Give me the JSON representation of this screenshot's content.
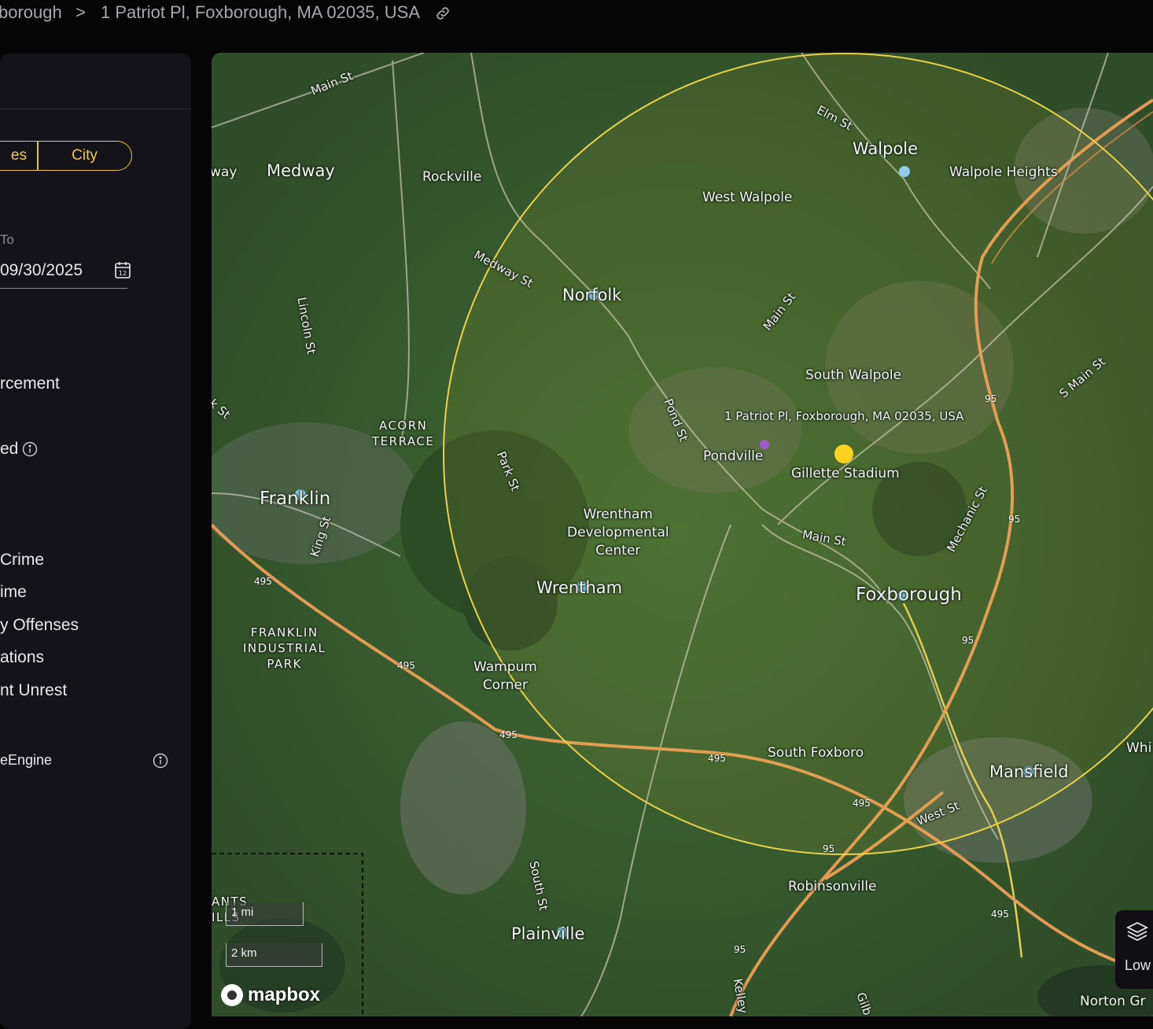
{
  "breadcrumb": {
    "parent": "borough",
    "separator": ">",
    "current": "1 Patriot Pl, Foxborough, MA 02035, USA"
  },
  "sidebar": {
    "segment": {
      "left": "es",
      "right": "City"
    },
    "date_to": {
      "label": "To",
      "value": "09/30/2025"
    },
    "items": [
      {
        "label": "rcement"
      },
      {
        "label": "ed"
      },
      {
        "label": "Crime"
      },
      {
        "label": "ime"
      },
      {
        "label": "y Offenses"
      },
      {
        "label": "ations"
      },
      {
        "label": "nt Unrest"
      }
    ],
    "engine_label": "eEngine"
  },
  "map": {
    "towns": {
      "medway": "Medway",
      "way": "way",
      "rockville": "Rockville",
      "walpole": "Walpole",
      "walpole_heights": "Walpole Heights",
      "west_walpole": "West Walpole",
      "norfolk": "Norfolk",
      "south_walpole": "South Walpole",
      "pondville": "Pondville",
      "franklin": "Franklin",
      "wrentham": "Wrentham",
      "foxborough": "Foxborough",
      "wampum": "Wampum\nCorner",
      "south_foxboro": "South Foxboro",
      "mansfield": "Mansfield",
      "robinsonville": "Robinsonville",
      "plainville": "Plainville",
      "norton": "Norton Gr",
      "whi": "Whi"
    },
    "caps": {
      "acorn": "ACORN\nTERRACE",
      "franklin_ind": "FRANKLIN\nINDUSTRIAL\nPARK",
      "ants": "ANTS\nILLS"
    },
    "poi": {
      "wdc": "Wrentham\nDevelopmental\nCenter",
      "gillette": "Gillette Stadium"
    },
    "address_label": "1 Patriot Pl, Foxborough, MA 02035, USA",
    "roads": {
      "main_st_top": "Main St",
      "elm_st": "Elm St",
      "medway_st": "Medway St",
      "lincoln_st": "Lincoln St",
      "main_st_mid": "Main St",
      "pond_st": "Pond St",
      "park_st": "Park St",
      "k_st": "k St",
      "king_st": "King St",
      "main_st_fox": "Main St",
      "mechanic_st": "Mechanic St",
      "s_main_st": "S Main St",
      "west_st": "West St",
      "south_st": "South St",
      "kelley": "Kelley",
      "gilb": "Gilb"
    },
    "shields": {
      "i495": "495",
      "i95": "95"
    },
    "scale": {
      "mi": "1 mi",
      "km": "2 km"
    },
    "attribution": "mapbox",
    "layer_label": "Low"
  },
  "colors": {
    "accent": "#efcd47",
    "radius_ring": "#e8d24a",
    "highway": "#e39a55",
    "marker_location": "#ffd21f",
    "marker_poi": "#8ccdf0",
    "marker_purple": "#9a5fc7",
    "panel_bg": "#141319"
  }
}
